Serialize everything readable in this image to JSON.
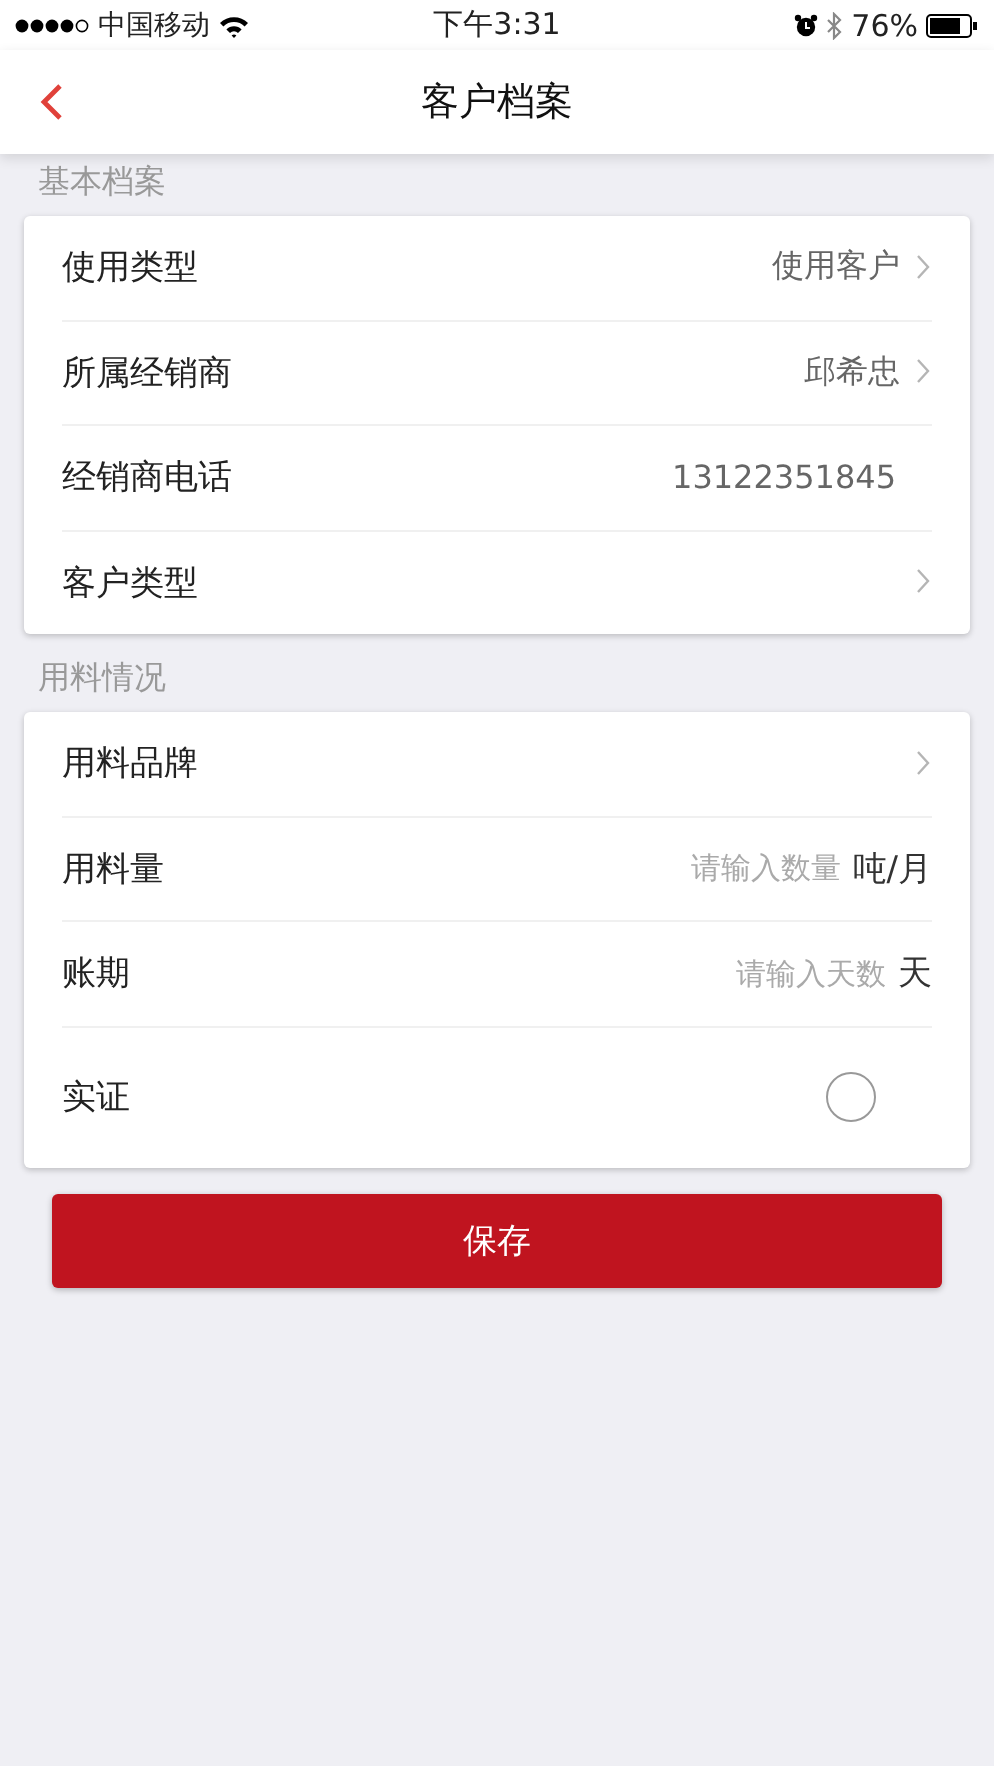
{
  "status_bar": {
    "carrier": "中国移动",
    "time": "下午3:31",
    "battery": "76%"
  },
  "nav": {
    "title": "客户档案"
  },
  "sections": [
    {
      "title": "基本档案",
      "rows": [
        {
          "kind": "select",
          "label": "使用类型",
          "value": "使用客户"
        },
        {
          "kind": "select",
          "label": "所属经销商",
          "value": "邱希忠"
        },
        {
          "kind": "text",
          "label": "经销商电话",
          "value": "13122351845"
        },
        {
          "kind": "select",
          "label": "客户类型"
        }
      ]
    },
    {
      "title": "用料情况",
      "rows": [
        {
          "kind": "select",
          "label": "用料品牌"
        },
        {
          "kind": "input",
          "label": "用料量",
          "placeholder": "请输入数量",
          "unit": "吨/月"
        },
        {
          "kind": "input",
          "label": "账期",
          "placeholder": "请输入天数",
          "unit": "天"
        },
        {
          "kind": "toggle",
          "label": "实证",
          "checked": false
        }
      ]
    }
  ],
  "save_button": "保存"
}
